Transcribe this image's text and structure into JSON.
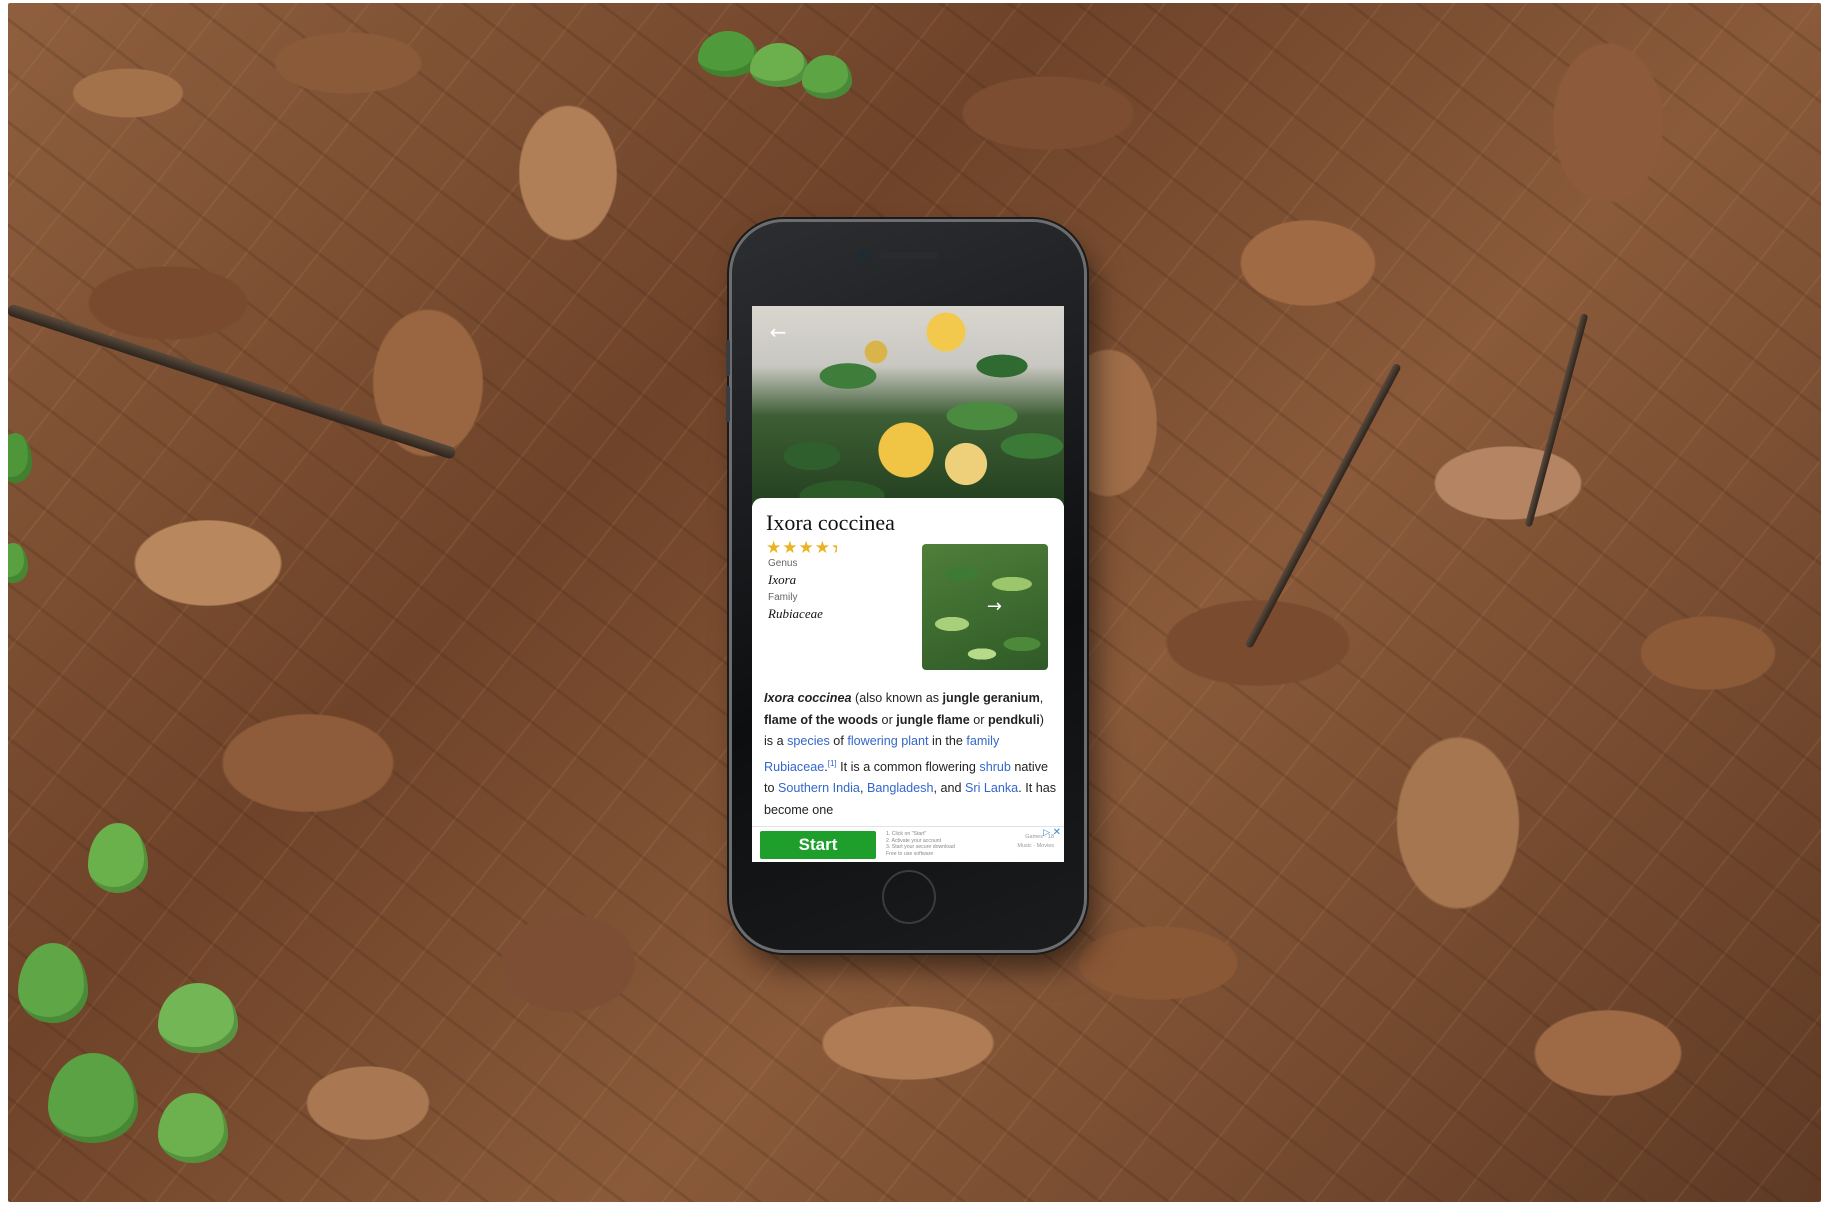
{
  "plant": {
    "title": "Ixora coccinea",
    "rating": 4.5,
    "stars_full": "★★★★",
    "stars_half": "★",
    "genus": {
      "label": "Genus",
      "value": "Ixora"
    },
    "family": {
      "label": "Family",
      "value": "Rubiaceae"
    },
    "description": {
      "name": "Ixora coccinea",
      "t1": " (also known as ",
      "b1": "jungle geranium",
      "t2": ", ",
      "b2": "flame of the woods",
      "t3": " or ",
      "b3": "jungle flame",
      "t4": " or ",
      "b4": "pendkuli",
      "t5": ") is a ",
      "l1": "species",
      "t6": " of ",
      "l2": "flowering plant",
      "t7": " in the ",
      "l3": "family",
      "t8": " ",
      "l4": "Rubiaceae",
      "t9": ".",
      "ref": "[1]",
      "t10": " It is a common flowering ",
      "l5": "shrub",
      "t11": " native to ",
      "l6": "Southern India",
      "t12": ", ",
      "l7": "Bangladesh",
      "t13": ", and ",
      "l8": "Sri Lanka",
      "t14": ". It has become one"
    }
  },
  "nav": {
    "back_icon": "←",
    "thumb_icon": "→"
  },
  "ad": {
    "button_label": "Start",
    "step1": "1. Click on \"Start\"",
    "step2": "2. Activate your account",
    "step3": "3. Start your secure download",
    "step4": "Free to use software",
    "meta1": "Games · 18",
    "meta2": "Music · Movies",
    "play_icon": "▷",
    "close_icon": "✕"
  },
  "colors": {
    "stars": "#e9b321",
    "link": "#3366cc",
    "ad_button": "#1e9e2a",
    "ad_icon": "#2a8bd6"
  }
}
